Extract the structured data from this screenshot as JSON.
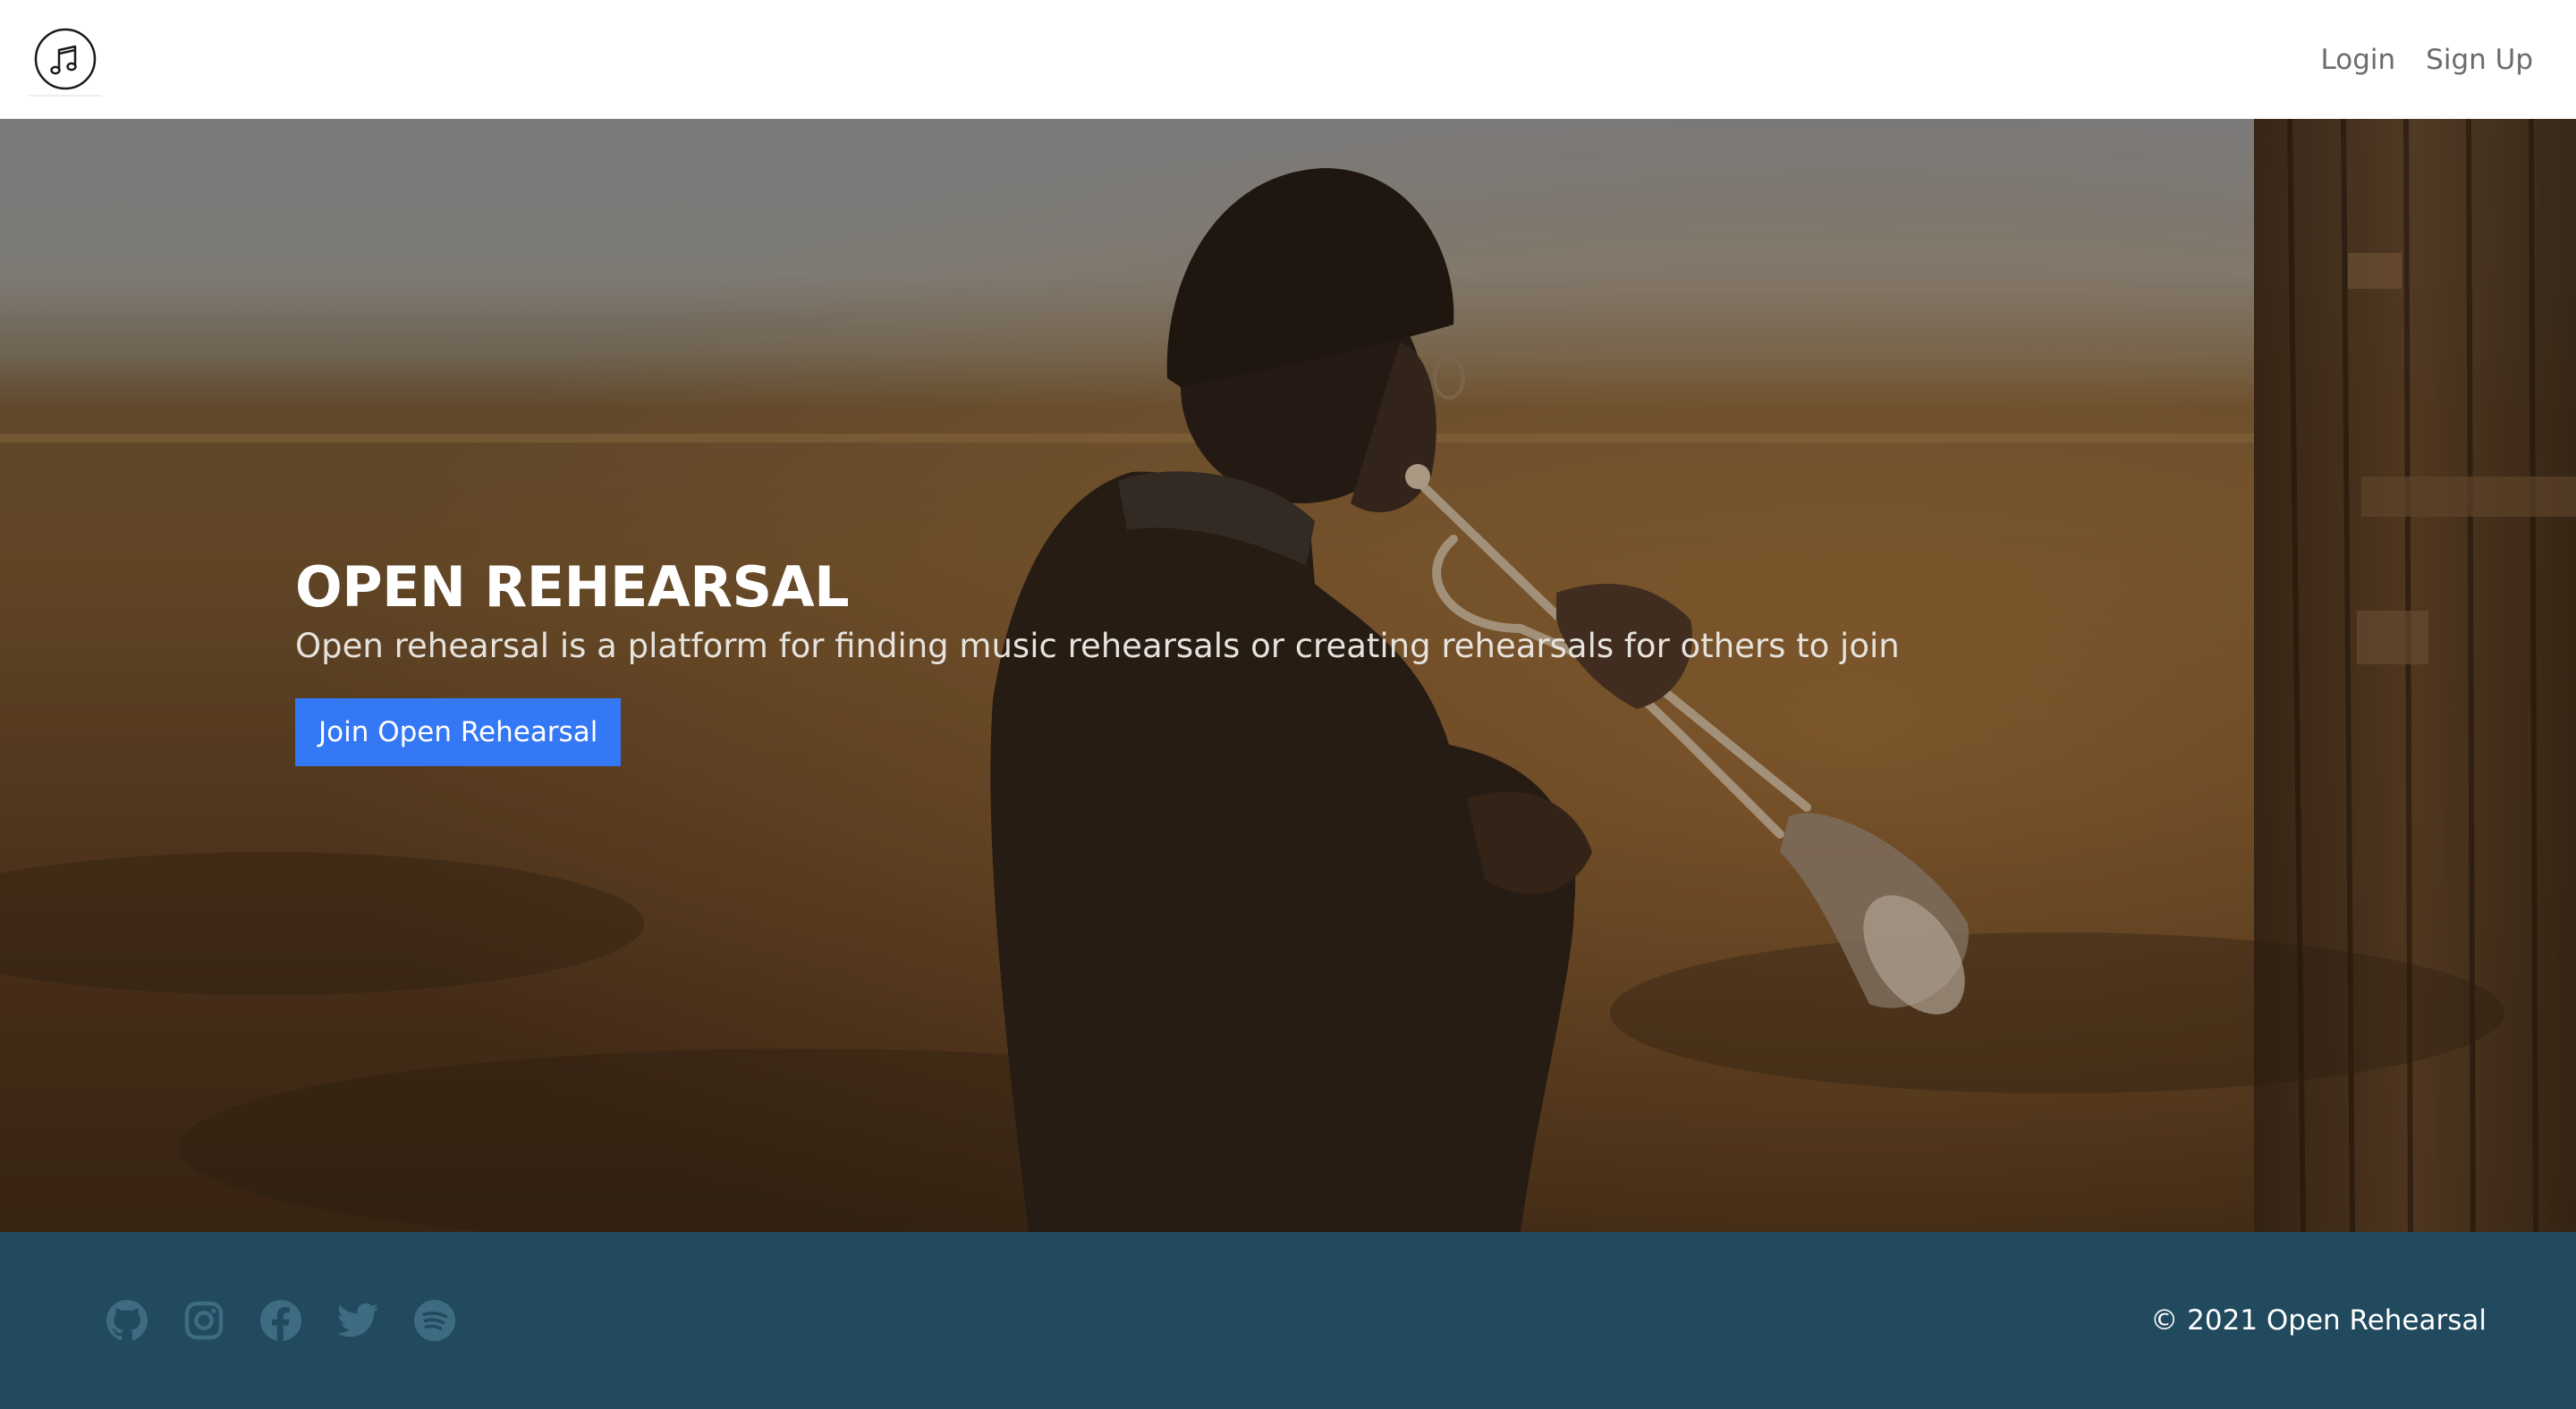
{
  "header": {
    "logo_icon": "music-note-circle-icon",
    "nav": {
      "login_label": "Login",
      "signup_label": "Sign Up"
    }
  },
  "hero": {
    "title": "OPEN REHEARSAL",
    "subtitle": "Open rehearsal is a platform for finding music rehearsals or creating rehearsals for others to join",
    "cta_label": "Join Open Rehearsal",
    "background": "photo of a person playing a trumpet in a golden field at sunset"
  },
  "footer": {
    "social_icons": [
      "github-icon",
      "instagram-icon",
      "facebook-icon",
      "twitter-icon",
      "spotify-icon"
    ],
    "copyright": "© 2021 Open Rehearsal"
  },
  "colors": {
    "accent": "#3478f6",
    "footer_bg": "#214a5e",
    "social_icon": "#3d6c82",
    "nav_text": "#6b6b6b"
  }
}
